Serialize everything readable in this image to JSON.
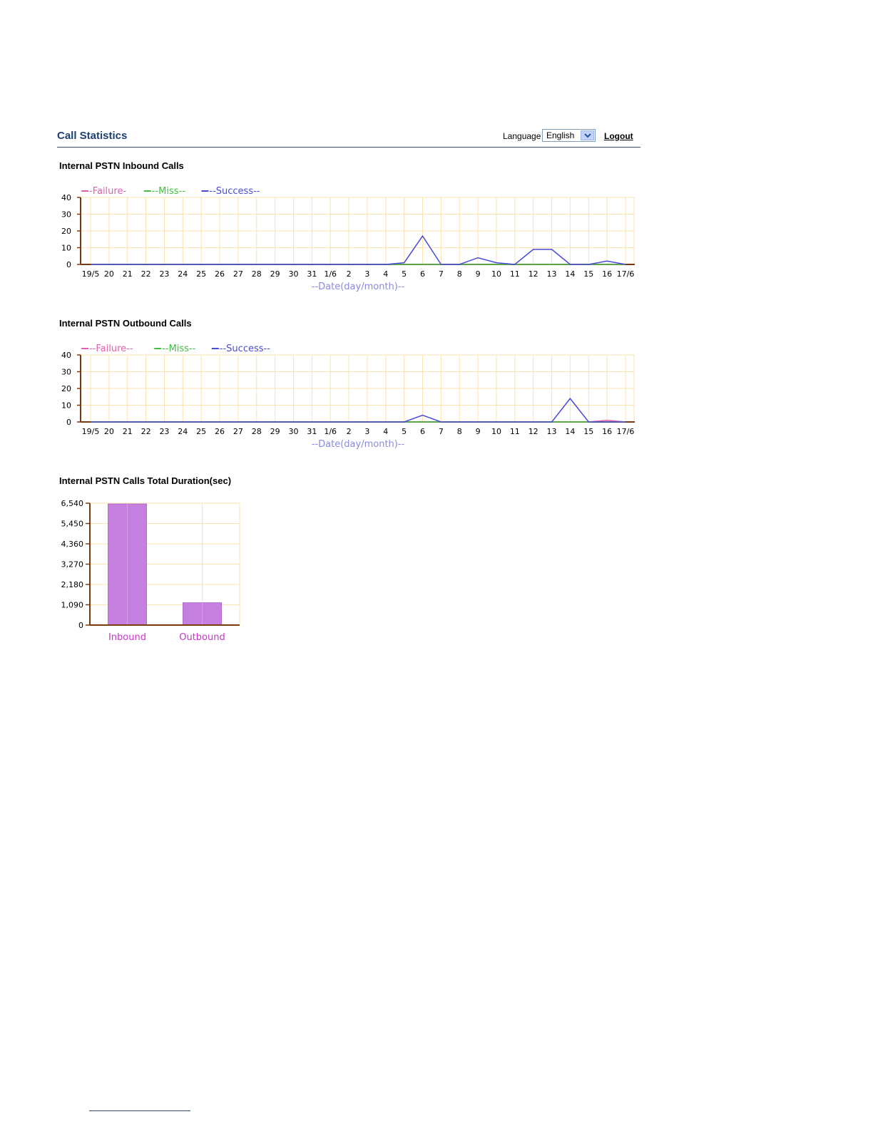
{
  "header": {
    "title": "Call Statistics",
    "language_label": "Language",
    "language_value": "English",
    "logout_label": "Logout"
  },
  "colors": {
    "failure": "#e060b0",
    "miss": "#40c040",
    "success": "#4a4ad8",
    "bar_fill": "#c57fdf",
    "axis": "#7a3a10",
    "grid": "#fbe3b0",
    "xlabel": "#8a8ae0",
    "bar_category": "#cc33cc"
  },
  "sections": {
    "inbound_title": "Internal PSTN Inbound Calls",
    "outbound_title": "Internal PSTN Outbound Calls",
    "duration_title": "Internal PSTN Calls Total Duration(sec)"
  },
  "chart_data": [
    {
      "type": "line",
      "title": "Internal PSTN Inbound Calls",
      "xlabel": "--Date(day/month)--",
      "ylabel": "",
      "ylim": [
        0,
        40
      ],
      "yticks": [
        0,
        10,
        20,
        30,
        40
      ],
      "grid": true,
      "legend": "top-left",
      "x": [
        "19/5",
        "20",
        "21",
        "22",
        "23",
        "24",
        "25",
        "26",
        "27",
        "28",
        "29",
        "30",
        "31",
        "1/6",
        "2",
        "3",
        "4",
        "5",
        "6",
        "7",
        "8",
        "9",
        "10",
        "11",
        "12",
        "13",
        "14",
        "15",
        "16",
        "17/6"
      ],
      "series": [
        {
          "name": "-Failure-",
          "color_key": "failure",
          "values": [
            0,
            0,
            0,
            0,
            0,
            0,
            0,
            0,
            0,
            0,
            0,
            0,
            0,
            0,
            0,
            0,
            0,
            0,
            0,
            0,
            0,
            0,
            0,
            0,
            0,
            0,
            0,
            0,
            0,
            0
          ]
        },
        {
          "name": "--Miss--",
          "color_key": "miss",
          "values": [
            0,
            0,
            0,
            0,
            0,
            0,
            0,
            0,
            0,
            0,
            0,
            0,
            0,
            0,
            0,
            0,
            0,
            0,
            0,
            0,
            0,
            0,
            0,
            0,
            0,
            0,
            0,
            0,
            0,
            0
          ]
        },
        {
          "name": "--Success--",
          "color_key": "success",
          "values": [
            0,
            0,
            0,
            0,
            0,
            0,
            0,
            0,
            0,
            0,
            0,
            0,
            0,
            0,
            0,
            0,
            0,
            1,
            17,
            0,
            0,
            4,
            1,
            0,
            9,
            9,
            0,
            0,
            2,
            0
          ]
        }
      ]
    },
    {
      "type": "line",
      "title": "Internal PSTN Outbound Calls",
      "xlabel": "--Date(day/month)--",
      "ylabel": "",
      "ylim": [
        0,
        40
      ],
      "yticks": [
        0,
        10,
        20,
        30,
        40
      ],
      "grid": true,
      "legend": "top-left",
      "x": [
        "19/5",
        "20",
        "21",
        "22",
        "23",
        "24",
        "25",
        "26",
        "27",
        "28",
        "29",
        "30",
        "31",
        "1/6",
        "2",
        "3",
        "4",
        "5",
        "6",
        "7",
        "8",
        "9",
        "10",
        "11",
        "12",
        "13",
        "14",
        "15",
        "16",
        "17/6"
      ],
      "series": [
        {
          "name": "--Failure--",
          "color_key": "failure",
          "values": [
            0,
            0,
            0,
            0,
            0,
            0,
            0,
            0,
            0,
            0,
            0,
            0,
            0,
            0,
            0,
            0,
            0,
            0,
            0,
            0,
            0,
            0,
            0,
            0,
            0,
            0,
            0,
            0,
            1,
            0
          ]
        },
        {
          "name": "--Miss--",
          "color_key": "miss",
          "values": [
            0,
            0,
            0,
            0,
            0,
            0,
            0,
            0,
            0,
            0,
            0,
            0,
            0,
            0,
            0,
            0,
            0,
            0,
            0,
            0,
            0,
            0,
            0,
            0,
            0,
            0,
            0,
            0,
            0,
            0
          ]
        },
        {
          "name": "--Success--",
          "color_key": "success",
          "values": [
            0,
            0,
            0,
            0,
            0,
            0,
            0,
            0,
            0,
            0,
            0,
            0,
            0,
            0,
            0,
            0,
            0,
            0,
            4,
            0,
            0,
            0,
            0,
            0,
            0,
            0,
            14,
            0,
            0,
            0
          ]
        }
      ]
    },
    {
      "type": "bar",
      "title": "Internal PSTN Calls Total Duration(sec)",
      "xlabel": "",
      "ylabel": "",
      "ylim": [
        0,
        6540
      ],
      "yticks": [
        "0",
        "1,090",
        "2,180",
        "3,270",
        "4,360",
        "5,450",
        "6,540"
      ],
      "ytick_values": [
        0,
        1090,
        2180,
        3270,
        4360,
        5450,
        6540
      ],
      "grid": true,
      "categories": [
        "Inbound",
        "Outbound"
      ],
      "values": [
        6500,
        1200
      ]
    }
  ]
}
